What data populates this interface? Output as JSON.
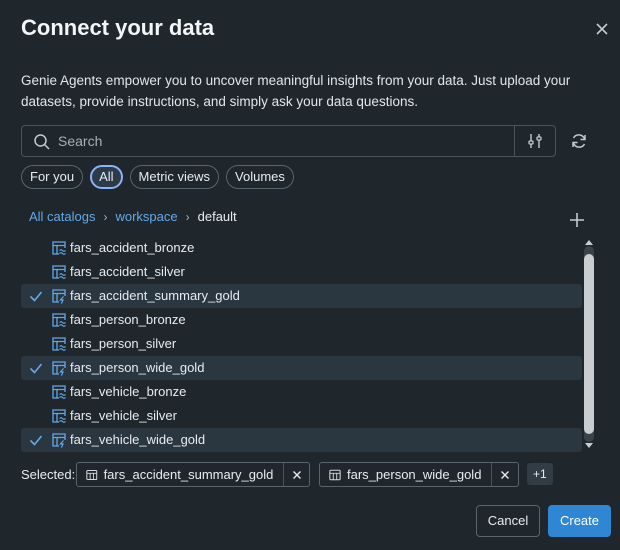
{
  "dialog": {
    "title": "Connect your data",
    "description": "Genie Agents empower you to uncover meaningful insights from your data. Just upload your datasets, provide instructions, and simply ask your data questions."
  },
  "search": {
    "placeholder": "Search",
    "value": ""
  },
  "chips": [
    {
      "label": "For you",
      "active": false
    },
    {
      "label": "All",
      "active": true
    },
    {
      "label": "Metric views",
      "active": false
    },
    {
      "label": "Volumes",
      "active": false
    }
  ],
  "breadcrumb": {
    "catalogs": "All catalogs",
    "separator": "›",
    "workspace": "workspace",
    "current": "default"
  },
  "tables": [
    {
      "name": "fars_accident_bronze",
      "selected": false,
      "icon": "table-stream-icon"
    },
    {
      "name": "fars_accident_silver",
      "selected": false,
      "icon": "table-stream-icon"
    },
    {
      "name": "fars_accident_summary_gold",
      "selected": true,
      "icon": "table-bolt-icon"
    },
    {
      "name": "fars_person_bronze",
      "selected": false,
      "icon": "table-stream-icon"
    },
    {
      "name": "fars_person_silver",
      "selected": false,
      "icon": "table-stream-icon"
    },
    {
      "name": "fars_person_wide_gold",
      "selected": true,
      "icon": "table-bolt-icon"
    },
    {
      "name": "fars_vehicle_bronze",
      "selected": false,
      "icon": "table-stream-icon"
    },
    {
      "name": "fars_vehicle_silver",
      "selected": false,
      "icon": "table-stream-icon"
    },
    {
      "name": "fars_vehicle_wide_gold",
      "selected": true,
      "icon": "table-bolt-icon"
    }
  ],
  "selection": {
    "label": "Selected:",
    "tags": [
      "fars_accident_summary_gold",
      "fars_person_wide_gold"
    ],
    "more": "+1"
  },
  "footer": {
    "cancel": "Cancel",
    "create": "Create"
  },
  "colors": {
    "accent": "#2f86d3",
    "link": "#62a8ea",
    "icon": "#62a8ea",
    "background": "#1f272d"
  }
}
